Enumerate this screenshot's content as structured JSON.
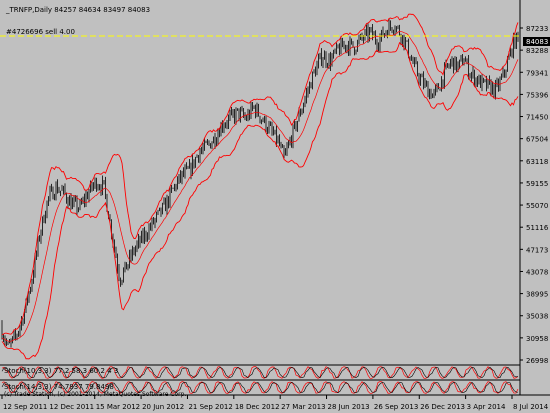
{
  "window": {
    "symbol_header": "_TRNFP,Daily  84257 84634 83497 84083",
    "order_label": "#4726696 sell 4.00",
    "current_price_tag": "84083",
    "copyright": "(c) Trade Station, (c) 2001-2014, MetaQuotes Software Corp."
  },
  "indicators": [
    {
      "label": "Stoch(10,3,3) 77.2 58.3  60.2  4  3"
    },
    {
      "label": "Stoch(14,3,3) 74.7837  79.8498"
    }
  ],
  "colors": {
    "background": "#c0c0c0",
    "candles": "#000000",
    "bands": "#ff0000",
    "order_line": "#ffff00",
    "price_tag_bg": "#000000",
    "price_tag_text": "#ffffff"
  },
  "chart_data": {
    "type": "candlestick",
    "price_axis_labels": [
      "87233",
      "83288",
      "79341",
      "75396",
      "71450",
      "67504",
      "63118",
      "59155",
      "55070",
      "51116",
      "47173",
      "43078",
      "38995",
      "35038",
      "30958",
      "26998"
    ],
    "ylim": [
      26998,
      87233
    ],
    "x_tick_labels": [
      "12 Sep 2011",
      "12 Dec 2011",
      "15 Mar 2012",
      "20 Jun 2012",
      "21 Sep 2012",
      "18 Dec 2012",
      "27 Mar 2013",
      "28 Jun 2013",
      "26 Sep 2013",
      "26 Dec 2013",
      "3 Apr 2014",
      "8 Jul 2014"
    ],
    "close_trend": [
      [
        0,
        34000
      ],
      [
        8,
        30000
      ],
      [
        16,
        32000
      ],
      [
        24,
        36000
      ],
      [
        32,
        42000
      ],
      [
        40,
        50000
      ],
      [
        48,
        56000
      ],
      [
        56,
        58000
      ],
      [
        64,
        57000
      ],
      [
        72,
        55000
      ],
      [
        80,
        54500
      ],
      [
        88,
        57000
      ],
      [
        96,
        59000
      ],
      [
        104,
        58000
      ],
      [
        110,
        52000
      ],
      [
        116,
        46000
      ],
      [
        120,
        42000
      ],
      [
        126,
        44000
      ],
      [
        134,
        47000
      ],
      [
        142,
        49000
      ],
      [
        150,
        51000
      ],
      [
        158,
        53000
      ],
      [
        166,
        55000
      ],
      [
        174,
        58000
      ],
      [
        182,
        60000
      ],
      [
        190,
        61000
      ],
      [
        198,
        64000
      ],
      [
        206,
        65000
      ],
      [
        214,
        66500
      ],
      [
        222,
        69000
      ],
      [
        230,
        70000
      ],
      [
        238,
        71000
      ],
      [
        246,
        70000
      ],
      [
        254,
        72000
      ],
      [
        262,
        70000
      ],
      [
        270,
        68000
      ],
      [
        278,
        66000
      ],
      [
        284,
        63000
      ],
      [
        290,
        66000
      ],
      [
        298,
        70000
      ],
      [
        306,
        74000
      ],
      [
        314,
        78000
      ],
      [
        322,
        81000
      ],
      [
        330,
        80000
      ],
      [
        338,
        82000
      ],
      [
        346,
        83000
      ],
      [
        354,
        82500
      ],
      [
        362,
        84000
      ],
      [
        370,
        85000
      ],
      [
        378,
        83500
      ],
      [
        386,
        85500
      ],
      [
        394,
        86500
      ],
      [
        400,
        85000
      ],
      [
        406,
        83000
      ],
      [
        412,
        80000
      ],
      [
        420,
        77000
      ],
      [
        428,
        75000
      ],
      [
        434,
        74000
      ],
      [
        440,
        76000
      ],
      [
        446,
        78500
      ],
      [
        452,
        80000
      ],
      [
        458,
        79000
      ],
      [
        464,
        80500
      ],
      [
        470,
        78000
      ],
      [
        476,
        77000
      ],
      [
        482,
        76000
      ],
      [
        490,
        75500
      ],
      [
        496,
        75000
      ],
      [
        502,
        77000
      ],
      [
        508,
        80000
      ],
      [
        514,
        83500
      ],
      [
        520,
        84083
      ]
    ]
  }
}
